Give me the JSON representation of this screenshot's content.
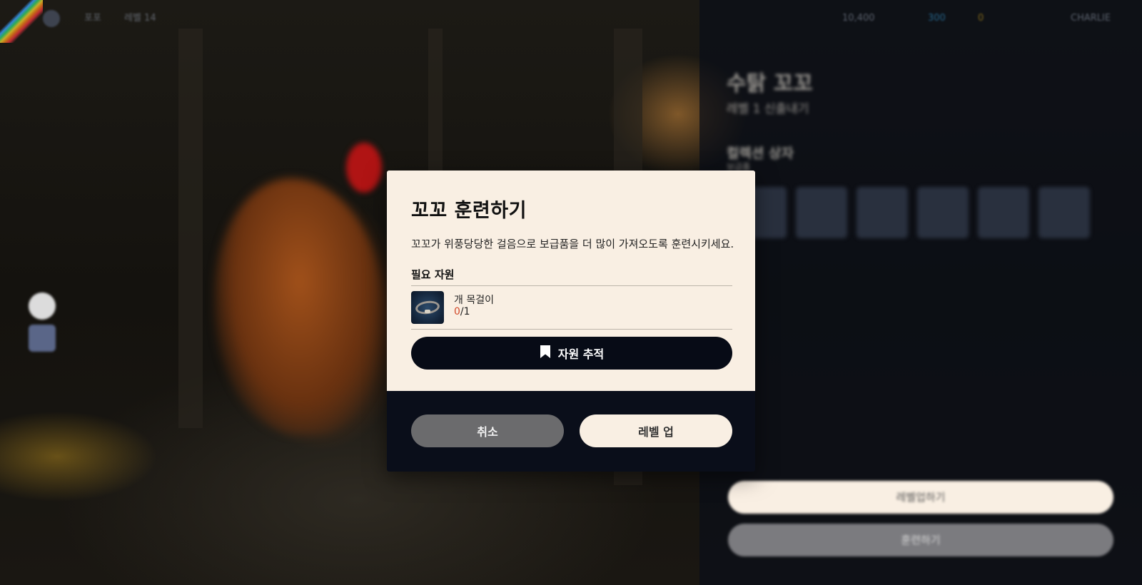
{
  "background": {
    "topbar": {
      "nav_items": [
        "포포",
        "레벨 14"
      ],
      "currency_1": "10,400",
      "currency_2": "300",
      "currency_3": "0",
      "profile_name": "CHARLIE"
    },
    "right_panel": {
      "title": "수탉 꼬꼬",
      "subtitle": "레벨 1 신출내기",
      "section_title": "컬렉션 상자",
      "section_sub": "보급품",
      "primary_button": "레벨업하기",
      "secondary_button": "훈련하기"
    }
  },
  "dialog": {
    "title": "꼬꼬 훈련하기",
    "description": "꼬꼬가 위풍당당한 걸음으로 보급품을 더 많이 가져오도록 훈련시키세요.",
    "required_label": "필요 자원",
    "resource": {
      "name": "개 목걸이",
      "have": "0",
      "need": "/1"
    },
    "track_button": "자원 추적",
    "cancel_button": "취소",
    "levelup_button": "레벨 업"
  },
  "colors": {
    "dialog_bg": "#f9efe3",
    "dialog_footer_bg": "#0a0e1a",
    "dark_button": "#070b16",
    "cancel_button": "#6b6b6d",
    "insufficient": "#d24a2a"
  },
  "icons": [
    "bookmark-icon",
    "dog-collar-icon",
    "settings-icon",
    "home-icon",
    "currency-icon"
  ]
}
